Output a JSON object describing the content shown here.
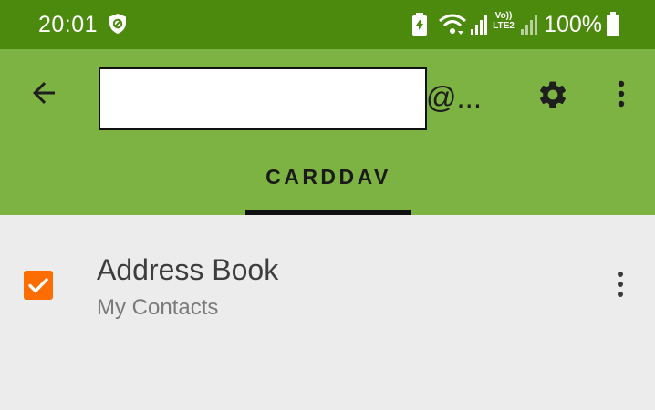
{
  "status_bar": {
    "time": "20:01",
    "battery_percent": "100%",
    "network": "LTE2",
    "volte": "Vo))",
    "icons": [
      "shield-icon",
      "battery-saver-icon",
      "wifi-icon",
      "signal-icon",
      "battery-icon"
    ]
  },
  "toolbar": {
    "account_suffix": "@...",
    "back_icon": "arrow-left-icon",
    "settings_icon": "gear-icon",
    "overflow_icon": "more-vert-icon"
  },
  "tabs": [
    {
      "label": "CARDDAV",
      "selected": true
    }
  ],
  "address_books": [
    {
      "title": "Address Book",
      "subtitle": "My Contacts",
      "checked": true
    }
  ],
  "colors": {
    "status_bar": "#4b8a0c",
    "app_bar": "#7cb342",
    "background": "#ececec",
    "checkbox": "#ff6d00"
  }
}
